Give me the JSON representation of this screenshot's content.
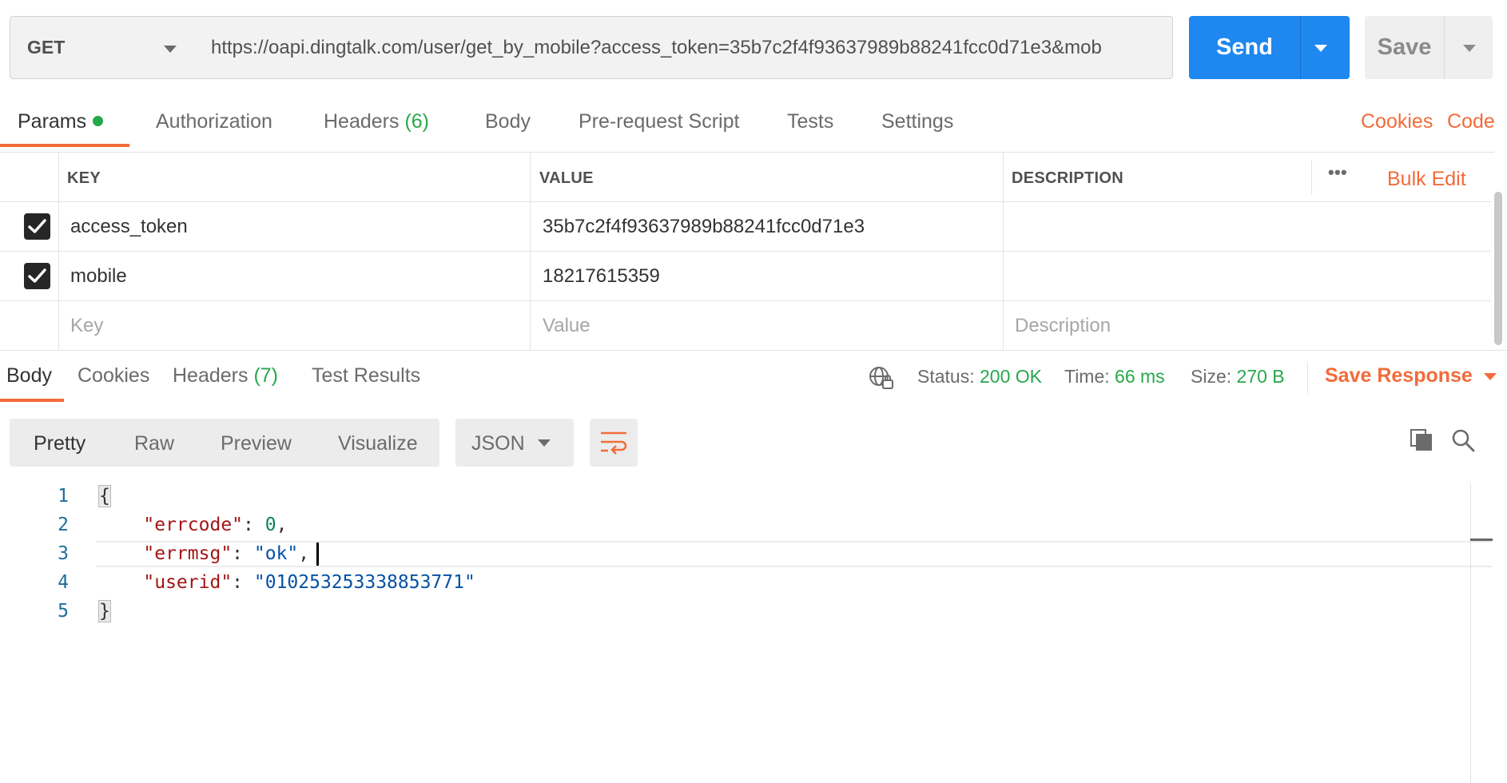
{
  "request": {
    "method": "GET",
    "url": "https://oapi.dingtalk.com/user/get_by_mobile?access_token=35b7c2f4f93637989b88241fcc0d71e3&mob",
    "send_label": "Send",
    "save_label": "Save"
  },
  "tabs": {
    "params": "Params",
    "authorization": "Authorization",
    "headers": "Headers",
    "headers_count": "(6)",
    "body": "Body",
    "pre_request": "Pre-request Script",
    "tests": "Tests",
    "settings": "Settings",
    "cookies": "Cookies",
    "code": "Code"
  },
  "params_table": {
    "columns": {
      "key": "KEY",
      "value": "VALUE",
      "description": "DESCRIPTION"
    },
    "bulk_edit": "Bulk Edit",
    "more": "•••",
    "rows": [
      {
        "checked": true,
        "key": "access_token",
        "value": "35b7c2f4f93637989b88241fcc0d71e3",
        "description": ""
      },
      {
        "checked": true,
        "key": "mobile",
        "value": "18217615359",
        "description": ""
      }
    ],
    "placeholders": {
      "key": "Key",
      "value": "Value",
      "description": "Description"
    }
  },
  "response": {
    "tabs": {
      "body": "Body",
      "cookies": "Cookies",
      "headers": "Headers",
      "headers_count": "(7)",
      "test_results": "Test Results"
    },
    "status_label": "Status:",
    "status_value": "200 OK",
    "time_label": "Time:",
    "time_value": "66 ms",
    "size_label": "Size:",
    "size_value": "270 B",
    "save_response": "Save Response",
    "view_modes": [
      "Pretty",
      "Raw",
      "Preview",
      "Visualize"
    ],
    "format": "JSON",
    "line_numbers": [
      "1",
      "2",
      "3",
      "4",
      "5"
    ],
    "json": {
      "errcode_key": "\"errcode\"",
      "errcode_value": "0",
      "errmsg_key": "\"errmsg\"",
      "errmsg_value": "\"ok\"",
      "userid_key": "\"userid\"",
      "userid_value": "\"010253253338853771\""
    }
  },
  "colors": {
    "accent": "#f26b3a",
    "send_blue": "#1e87f0",
    "status_green": "#26a84b"
  },
  "icons": [
    "caret-down-icon",
    "checkbox-checked-icon",
    "globe-lock-icon",
    "wrap-lines-icon",
    "copy-icon",
    "search-icon",
    "more-icon"
  ]
}
